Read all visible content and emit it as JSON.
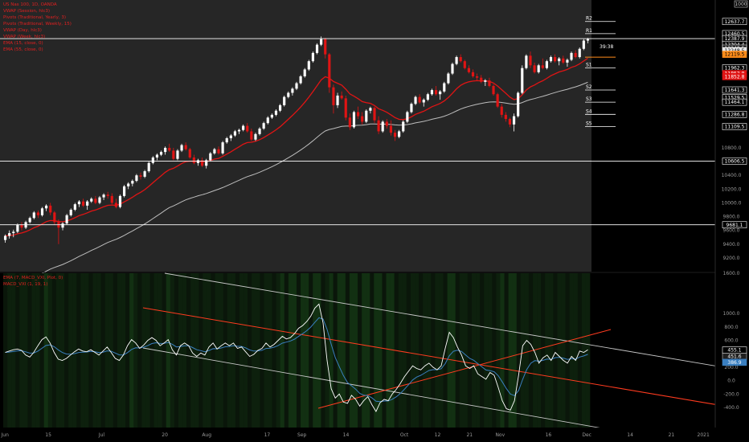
{
  "instrument": {
    "title": "US Nas 100, 1D, OANDA",
    "indicators_top": [
      "VWAP (Session, hlc3)",
      "Pivots (Traditional, Yearly, 3)",
      "Pivots (Traditional, Weekly, 15)",
      "VWAP (Day, hlc3)",
      "VWAP (Week, hlc3)",
      "EMA (15, close, 0)",
      "EMA (55, close, 0)"
    ],
    "indicators_bottom": [
      "EMA (7, MACD_VXI, Plot, 0)",
      "MACD_VXI (1, 19, 1)"
    ]
  },
  "top_axis_badge": "1000",
  "colors": {
    "background": "#000000",
    "plot_bg": "#262626",
    "up": "#ffffff",
    "down": "#e01414",
    "ema_fast": "#e01414",
    "ema_slow": "#bdbdbd",
    "channel": "#c8c8c8",
    "trend": "#ff3b1f",
    "osc_main": "#ffffff",
    "osc_signal": "#3a7fc0",
    "osc_bg": "#0d200d",
    "pivot_line": "#ffffff",
    "orange": "#ff8c1a"
  },
  "chart_data": [
    {
      "type": "candlestick",
      "ylim": [
        9000,
        12950
      ],
      "price_axis": {
        "ticks": [
          "10800.0",
          "10600.0",
          "10400.0",
          "10200.0",
          "10000.0",
          "9800.0",
          "9600.0",
          "9400.0",
          "9200.0"
        ],
        "labels": [
          {
            "text": "12637.7",
            "value": 12637.7,
            "style": "line"
          },
          {
            "text": "12460.5",
            "value": 12460.5,
            "style": "line"
          },
          {
            "text": "12387.9",
            "value": 12387.9,
            "style": "line"
          },
          {
            "text": "12304.4",
            "value": 12304.4,
            "style": "line"
          },
          {
            "text": "12248.5",
            "value": 12248.5,
            "style": "line"
          },
          {
            "text": "12248.5",
            "value": 12215.0,
            "style": "gray"
          },
          {
            "text": "12119.5",
            "value": 12160.0,
            "style": "orange"
          },
          {
            "text": "11962.3",
            "value": 11962.3,
            "style": "line"
          },
          {
            "text": "11852.8",
            "value": 11880.0,
            "style": "red"
          },
          {
            "text": "11852.8",
            "value": 11835.0,
            "style": "red"
          },
          {
            "text": "11641.3",
            "value": 11641.3,
            "style": "line"
          },
          {
            "text": "11529.5",
            "value": 11529.5,
            "style": "line"
          },
          {
            "text": "11464.1",
            "value": 11464.1,
            "style": "line"
          },
          {
            "text": "11286.8",
            "value": 11286.8,
            "style": "line"
          },
          {
            "text": "11109.5",
            "value": 11109.5,
            "style": "line"
          },
          {
            "text": "10606.5",
            "value": 10606.5,
            "style": "line"
          },
          {
            "text": "9681.1",
            "value": 9681.1,
            "style": "line"
          }
        ],
        "countdown": "39:38"
      },
      "pivots": [
        {
          "label": "R2",
          "value": 12637.7
        },
        {
          "label": "R1",
          "value": 12460.5
        },
        {
          "label": "S1",
          "value": 11962.3
        },
        {
          "label": "S2",
          "value": 11641.3
        },
        {
          "label": "S3",
          "value": 11464.1
        },
        {
          "label": "S4",
          "value": 11286.8
        },
        {
          "label": "S5",
          "value": 11109.5
        }
      ],
      "horizontal_levels": [
        12387.9,
        10606.5,
        9681.1
      ],
      "orange_level": 12119.5,
      "series": [
        {
          "name": "EMA (15, close, 0)"
        },
        {
          "name": "EMA (55, close, 0)"
        }
      ],
      "candles": [
        [
          9460,
          9540,
          9420,
          9520
        ],
        [
          9520,
          9600,
          9480,
          9560
        ],
        [
          9560,
          9610,
          9500,
          9580
        ],
        [
          9580,
          9700,
          9560,
          9680
        ],
        [
          9680,
          9720,
          9600,
          9640
        ],
        [
          9640,
          9740,
          9620,
          9720
        ],
        [
          9720,
          9800,
          9700,
          9780
        ],
        [
          9780,
          9880,
          9760,
          9860
        ],
        [
          9860,
          9890,
          9780,
          9820
        ],
        [
          9820,
          9940,
          9800,
          9920
        ],
        [
          9920,
          9980,
          9880,
          9960
        ],
        [
          9960,
          10000,
          9820,
          9860
        ],
        [
          9860,
          9880,
          9680,
          9720
        ],
        [
          9720,
          9760,
          9400,
          9640
        ],
        [
          9640,
          9720,
          9600,
          9700
        ],
        [
          9700,
          9840,
          9680,
          9820
        ],
        [
          9820,
          9920,
          9800,
          9900
        ],
        [
          9900,
          10000,
          9880,
          9980
        ],
        [
          9980,
          10040,
          9940,
          10020
        ],
        [
          10020,
          10060,
          9940,
          9960
        ],
        [
          9960,
          10040,
          9900,
          10020
        ],
        [
          10020,
          10080,
          10000,
          10060
        ],
        [
          10060,
          10100,
          9980,
          10000
        ],
        [
          10000,
          10100,
          9980,
          10080
        ],
        [
          10080,
          10140,
          10040,
          10120
        ],
        [
          10120,
          10160,
          10060,
          10100
        ],
        [
          10100,
          10140,
          9980,
          10000
        ],
        [
          10000,
          10060,
          9920,
          9940
        ],
        [
          9940,
          10120,
          9920,
          10100
        ],
        [
          10100,
          10260,
          10080,
          10240
        ],
        [
          10240,
          10300,
          10200,
          10280
        ],
        [
          10280,
          10340,
          10240,
          10320
        ],
        [
          10320,
          10420,
          10300,
          10400
        ],
        [
          10400,
          10440,
          10340,
          10380
        ],
        [
          10380,
          10480,
          10360,
          10460
        ],
        [
          10460,
          10600,
          10440,
          10580
        ],
        [
          10580,
          10680,
          10560,
          10660
        ],
        [
          10660,
          10720,
          10620,
          10700
        ],
        [
          10700,
          10760,
          10680,
          10740
        ],
        [
          10740,
          10820,
          10700,
          10800
        ],
        [
          10800,
          10860,
          10740,
          10760
        ],
        [
          10760,
          10800,
          10620,
          10640
        ],
        [
          10640,
          10780,
          10620,
          10760
        ],
        [
          10760,
          10860,
          10740,
          10840
        ],
        [
          10840,
          10880,
          10760,
          10780
        ],
        [
          10780,
          10800,
          10640,
          10660
        ],
        [
          10660,
          10700,
          10560,
          10580
        ],
        [
          10580,
          10640,
          10540,
          10620
        ],
        [
          10620,
          10660,
          10520,
          10540
        ],
        [
          10540,
          10640,
          10500,
          10620
        ],
        [
          10620,
          10740,
          10600,
          10720
        ],
        [
          10720,
          10800,
          10700,
          10780
        ],
        [
          10780,
          10820,
          10700,
          10720
        ],
        [
          10720,
          10900,
          10700,
          10880
        ],
        [
          10880,
          10960,
          10860,
          10940
        ],
        [
          10940,
          11000,
          10900,
          10980
        ],
        [
          10980,
          11060,
          10960,
          11040
        ],
        [
          11040,
          11080,
          11000,
          11060
        ],
        [
          11060,
          11140,
          11040,
          11120
        ],
        [
          11120,
          11160,
          11020,
          11040
        ],
        [
          11040,
          11080,
          10900,
          10920
        ],
        [
          10920,
          11020,
          10900,
          11000
        ],
        [
          11000,
          11100,
          10980,
          11080
        ],
        [
          11080,
          11180,
          11060,
          11160
        ],
        [
          11160,
          11260,
          11140,
          11240
        ],
        [
          11240,
          11300,
          11220,
          11280
        ],
        [
          11280,
          11360,
          11260,
          11340
        ],
        [
          11340,
          11440,
          11320,
          11420
        ],
        [
          11420,
          11560,
          11400,
          11540
        ],
        [
          11540,
          11620,
          11520,
          11600
        ],
        [
          11600,
          11680,
          11560,
          11660
        ],
        [
          11660,
          11760,
          11640,
          11740
        ],
        [
          11740,
          11860,
          11720,
          11840
        ],
        [
          11840,
          11960,
          11820,
          11940
        ],
        [
          11940,
          12080,
          11920,
          12060
        ],
        [
          12060,
          12200,
          12040,
          12180
        ],
        [
          12180,
          12320,
          12160,
          12300
        ],
        [
          12300,
          12420,
          12280,
          12380
        ],
        [
          12380,
          12400,
          12100,
          12160
        ],
        [
          12160,
          12180,
          11600,
          11680
        ],
        [
          11680,
          11720,
          11300,
          11420
        ],
        [
          11420,
          11600,
          11380,
          11560
        ],
        [
          11560,
          11620,
          11500,
          11520
        ],
        [
          11520,
          11560,
          11200,
          11240
        ],
        [
          11240,
          11300,
          11060,
          11100
        ],
        [
          11100,
          11340,
          11080,
          11320
        ],
        [
          11320,
          11400,
          11220,
          11260
        ],
        [
          11260,
          11320,
          11140,
          11180
        ],
        [
          11180,
          11360,
          11160,
          11340
        ],
        [
          11340,
          11400,
          11300,
          11380
        ],
        [
          11380,
          11400,
          11160,
          11200
        ],
        [
          11200,
          11260,
          11000,
          11040
        ],
        [
          11040,
          11200,
          11020,
          11180
        ],
        [
          11180,
          11220,
          11080,
          11120
        ],
        [
          11120,
          11200,
          10980,
          11020
        ],
        [
          11020,
          11060,
          10900,
          10960
        ],
        [
          10960,
          11060,
          10940,
          11040
        ],
        [
          11040,
          11200,
          11020,
          11180
        ],
        [
          11180,
          11340,
          11160,
          11320
        ],
        [
          11320,
          11460,
          11300,
          11440
        ],
        [
          11440,
          11560,
          11420,
          11540
        ],
        [
          11540,
          11580,
          11440,
          11460
        ],
        [
          11460,
          11520,
          11400,
          11500
        ],
        [
          11500,
          11600,
          11480,
          11580
        ],
        [
          11580,
          11660,
          11560,
          11640
        ],
        [
          11640,
          11700,
          11560,
          11580
        ],
        [
          11580,
          11640,
          11500,
          11620
        ],
        [
          11620,
          11760,
          11600,
          11740
        ],
        [
          11740,
          11900,
          11720,
          11880
        ],
        [
          11880,
          12040,
          11860,
          12020
        ],
        [
          12020,
          12140,
          12000,
          12120
        ],
        [
          12120,
          12160,
          12040,
          12060
        ],
        [
          12060,
          12080,
          11940,
          11960
        ],
        [
          11960,
          12000,
          11880,
          11900
        ],
        [
          11900,
          11940,
          11820,
          11840
        ],
        [
          11840,
          11880,
          11780,
          11820
        ],
        [
          11820,
          11860,
          11740,
          11760
        ],
        [
          11760,
          11800,
          11700,
          11780
        ],
        [
          11780,
          11820,
          11680,
          11700
        ],
        [
          11700,
          11720,
          11560,
          11580
        ],
        [
          11580,
          11600,
          11380,
          11400
        ],
        [
          11400,
          11440,
          11240,
          11280
        ],
        [
          11280,
          11320,
          11180,
          11220
        ],
        [
          11220,
          11240,
          11100,
          11140
        ],
        [
          11140,
          11300,
          11040,
          11260
        ],
        [
          11260,
          11620,
          11240,
          11600
        ],
        [
          11600,
          12000,
          11580,
          11960
        ],
        [
          11960,
          12160,
          11940,
          12140
        ],
        [
          12140,
          12200,
          11960,
          12000
        ],
        [
          12000,
          12040,
          11880,
          11900
        ],
        [
          11900,
          12020,
          11880,
          12000
        ],
        [
          12000,
          12100,
          11940,
          11960
        ],
        [
          11960,
          12080,
          11940,
          12060
        ],
        [
          12060,
          12140,
          12040,
          12120
        ],
        [
          12120,
          12160,
          12040,
          12060
        ],
        [
          12060,
          12120,
          12000,
          12100
        ],
        [
          12100,
          12140,
          12020,
          12040
        ],
        [
          12040,
          12100,
          11980,
          12080
        ],
        [
          12080,
          12200,
          12060,
          12180
        ],
        [
          12180,
          12220,
          12100,
          12120
        ],
        [
          12120,
          12260,
          12100,
          12240
        ],
        [
          12240,
          12380,
          12220,
          12360
        ],
        [
          12360,
          12400,
          12320,
          12380
        ]
      ]
    },
    {
      "type": "line",
      "ylim": [
        -700,
        1600
      ],
      "axis_ticks": [
        "1600.0",
        "1000.0",
        "800.0",
        "600.0",
        "200.0",
        "0.0",
        "-200.0",
        "-400.0"
      ],
      "value_labels": [
        {
          "text": "455.1",
          "value": 455.1,
          "style": "line"
        },
        {
          "text": "451.6",
          "value": 360,
          "style": "dark"
        },
        {
          "text": "386.9",
          "value": 272,
          "style": "blue"
        }
      ],
      "series": [
        {
          "name": "EMA (7, MACD_VXI, Plot, 0)"
        },
        {
          "name": "MACD_VXI (1, 19, 1)"
        }
      ],
      "main": [
        420,
        440,
        460,
        470,
        450,
        380,
        350,
        420,
        520,
        610,
        650,
        560,
        420,
        320,
        300,
        330,
        380,
        430,
        470,
        440,
        430,
        460,
        420,
        380,
        440,
        500,
        420,
        330,
        300,
        380,
        520,
        610,
        560,
        480,
        530,
        600,
        640,
        600,
        520,
        560,
        610,
        460,
        380,
        520,
        560,
        520,
        410,
        360,
        410,
        380,
        500,
        560,
        470,
        520,
        560,
        520,
        560,
        480,
        500,
        430,
        360,
        390,
        450,
        480,
        560,
        500,
        540,
        600,
        660,
        620,
        640,
        700,
        780,
        820,
        880,
        960,
        1080,
        1140,
        860,
        300,
        -120,
        -260,
        -200,
        -320,
        -340,
        -220,
        -280,
        -380,
        -300,
        -240,
        -360,
        -460,
        -330,
        -280,
        -300,
        -200,
        -130,
        -40,
        60,
        140,
        220,
        180,
        160,
        220,
        260,
        200,
        160,
        220,
        480,
        720,
        640,
        500,
        380,
        220,
        180,
        220,
        100,
        60,
        20,
        120,
        80,
        -100,
        -300,
        -420,
        -440,
        -300,
        80,
        520,
        600,
        540,
        420,
        260,
        340,
        380,
        300,
        420,
        360,
        300,
        260,
        360,
        300,
        440,
        420,
        460
      ]
    }
  ],
  "time_axis": [
    "Jun",
    "15",
    "Jul",
    "20",
    "Aug",
    "17",
    "Sep",
    "14",
    "Oct",
    "12",
    "21",
    "Nov",
    "16",
    "Dec",
    "14",
    "21",
    "2021"
  ]
}
